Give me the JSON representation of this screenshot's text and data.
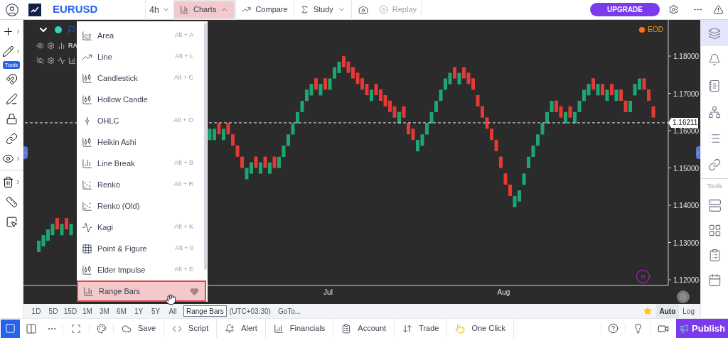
{
  "top_bar": {
    "symbol": "EURUSD",
    "interval": "4h",
    "buttons": [
      {
        "label": "Charts",
        "selected": true,
        "disabled": false,
        "kind": "charts"
      },
      {
        "label": "Compare",
        "selected": false,
        "disabled": false,
        "kind": "compare"
      },
      {
        "label": "Study",
        "selected": false,
        "disabled": false,
        "kind": "study"
      },
      {
        "label": "Replay",
        "selected": false,
        "disabled": true,
        "kind": "replay"
      }
    ],
    "upgrade": "UPGRADE"
  },
  "left_toolbar": {
    "tools_badge": "Tools"
  },
  "chart": {
    "legend_text": "RA",
    "feed_badge": "EOD",
    "price_label": "1.16211",
    "marker": "N",
    "time_labels": [
      "Jul",
      "Aug"
    ],
    "price_scale": [
      "1.18000",
      "1.17000",
      "1.16000",
      "1.15000",
      "1.14000",
      "1.13000",
      "1.12000"
    ]
  },
  "chart_type_menu": {
    "items": [
      {
        "label": "Area",
        "shortcut": "Alt + A",
        "selected": false
      },
      {
        "label": "Line",
        "shortcut": "Alt + L",
        "selected": false
      },
      {
        "label": "Candlestick",
        "shortcut": "Alt + C",
        "selected": false
      },
      {
        "label": "Hollow Candle",
        "selected": false
      },
      {
        "label": "OHLC",
        "shortcut": "Alt + O",
        "selected": false
      },
      {
        "label": "Heikin Ashi",
        "selected": false
      },
      {
        "label": "Line Break",
        "shortcut": "Alt + B",
        "selected": false
      },
      {
        "label": "Renko",
        "shortcut": "Alt + R",
        "selected": false
      },
      {
        "label": "Renko (Old)",
        "selected": false
      },
      {
        "label": "Kagi",
        "shortcut": "Alt + K",
        "selected": false
      },
      {
        "label": "Point & Figure",
        "shortcut": "Alt + 0",
        "selected": false
      },
      {
        "label": "Elder Impulse",
        "shortcut": "Alt + E",
        "selected": false
      },
      {
        "label": "Range Bars",
        "selected": true
      }
    ],
    "tooltip": "Range Bars"
  },
  "right_sidebar": {
    "items": [
      {
        "selected": true
      },
      {
        "selected": false
      },
      {
        "selected": false
      },
      {
        "selected": false
      },
      {
        "selected": false
      },
      {
        "selected": false
      }
    ],
    "section_label": "Tools"
  },
  "range_bar": {
    "ranges": [
      "1D",
      "5D",
      "15D",
      "1M",
      "3M",
      "6M",
      "1Y",
      "5Y",
      "All"
    ],
    "timezone": "(UTC+03:30)",
    "goto": "GoTo...",
    "scales": [
      {
        "label": "Auto",
        "selected": true
      },
      {
        "label": "Log",
        "selected": false
      }
    ]
  },
  "bottom_bar": {
    "layouts": [
      {
        "selected": true
      },
      {
        "selected": false
      }
    ],
    "actions": [
      "Save",
      "Script",
      "Alert",
      "Financials",
      "Account",
      "Trade",
      "One Click"
    ],
    "publish": "Publish"
  }
}
